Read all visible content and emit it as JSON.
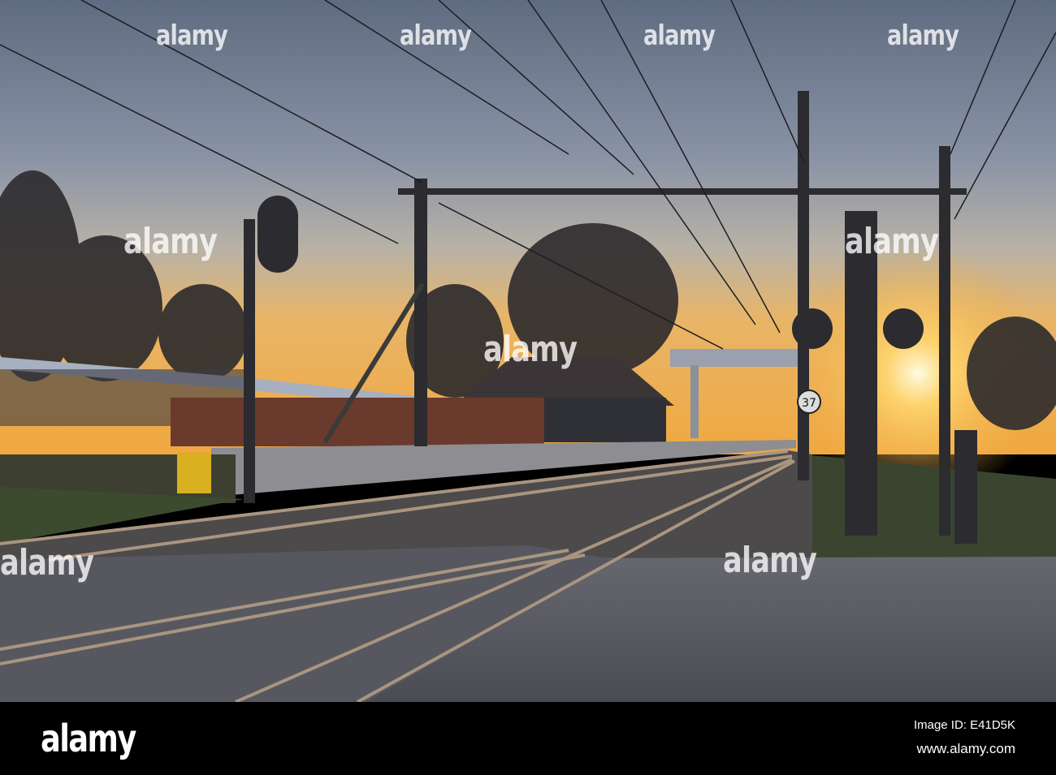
{
  "photo": {
    "subject": "railway-station-sunset",
    "watermark_text": "alamy",
    "sign_number": "37",
    "colors": {
      "sky_top": "#6f7d92",
      "sky_horizon": "#f2b04a",
      "sun": "#fff6d0",
      "ground": "#4f5058"
    }
  },
  "footer": {
    "logo": "alamy",
    "image_id": "Image ID: E41D5K",
    "website": "www.alamy.com"
  }
}
